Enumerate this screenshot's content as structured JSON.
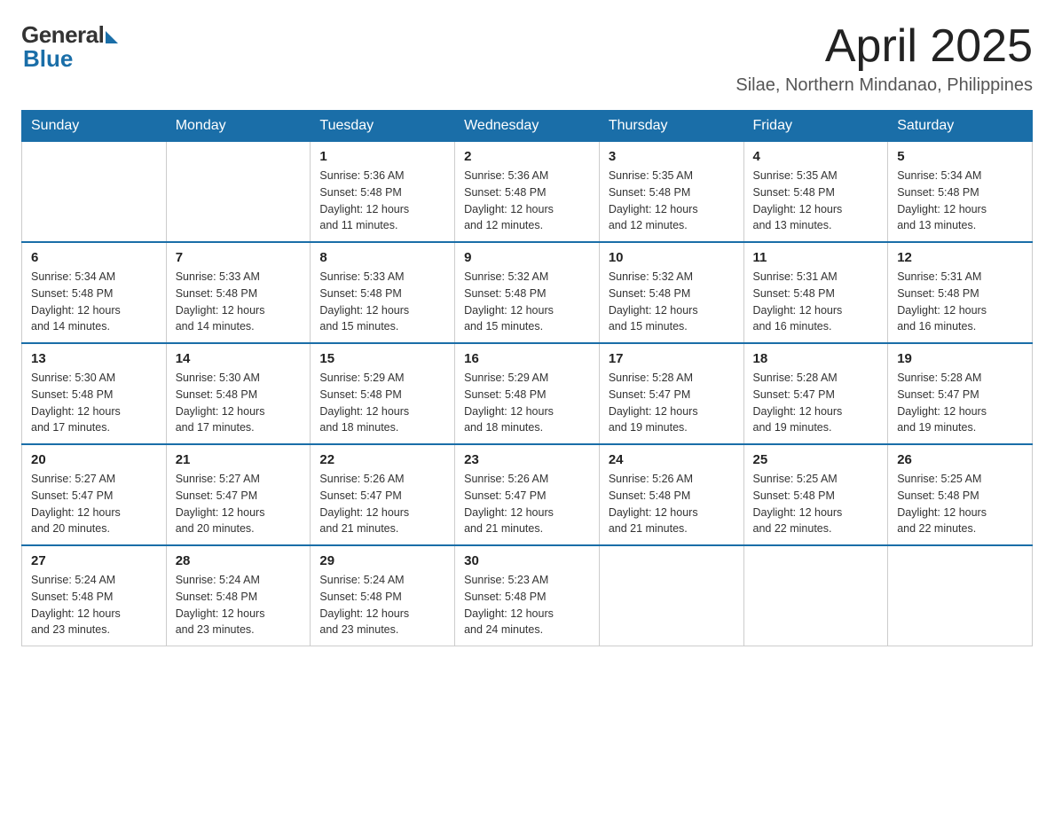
{
  "logo": {
    "general": "General",
    "blue": "Blue"
  },
  "header": {
    "month_year": "April 2025",
    "location": "Silae, Northern Mindanao, Philippines"
  },
  "columns": [
    "Sunday",
    "Monday",
    "Tuesday",
    "Wednesday",
    "Thursday",
    "Friday",
    "Saturday"
  ],
  "weeks": [
    [
      {
        "day": "",
        "info": ""
      },
      {
        "day": "",
        "info": ""
      },
      {
        "day": "1",
        "info": "Sunrise: 5:36 AM\nSunset: 5:48 PM\nDaylight: 12 hours\nand 11 minutes."
      },
      {
        "day": "2",
        "info": "Sunrise: 5:36 AM\nSunset: 5:48 PM\nDaylight: 12 hours\nand 12 minutes."
      },
      {
        "day": "3",
        "info": "Sunrise: 5:35 AM\nSunset: 5:48 PM\nDaylight: 12 hours\nand 12 minutes."
      },
      {
        "day": "4",
        "info": "Sunrise: 5:35 AM\nSunset: 5:48 PM\nDaylight: 12 hours\nand 13 minutes."
      },
      {
        "day": "5",
        "info": "Sunrise: 5:34 AM\nSunset: 5:48 PM\nDaylight: 12 hours\nand 13 minutes."
      }
    ],
    [
      {
        "day": "6",
        "info": "Sunrise: 5:34 AM\nSunset: 5:48 PM\nDaylight: 12 hours\nand 14 minutes."
      },
      {
        "day": "7",
        "info": "Sunrise: 5:33 AM\nSunset: 5:48 PM\nDaylight: 12 hours\nand 14 minutes."
      },
      {
        "day": "8",
        "info": "Sunrise: 5:33 AM\nSunset: 5:48 PM\nDaylight: 12 hours\nand 15 minutes."
      },
      {
        "day": "9",
        "info": "Sunrise: 5:32 AM\nSunset: 5:48 PM\nDaylight: 12 hours\nand 15 minutes."
      },
      {
        "day": "10",
        "info": "Sunrise: 5:32 AM\nSunset: 5:48 PM\nDaylight: 12 hours\nand 15 minutes."
      },
      {
        "day": "11",
        "info": "Sunrise: 5:31 AM\nSunset: 5:48 PM\nDaylight: 12 hours\nand 16 minutes."
      },
      {
        "day": "12",
        "info": "Sunrise: 5:31 AM\nSunset: 5:48 PM\nDaylight: 12 hours\nand 16 minutes."
      }
    ],
    [
      {
        "day": "13",
        "info": "Sunrise: 5:30 AM\nSunset: 5:48 PM\nDaylight: 12 hours\nand 17 minutes."
      },
      {
        "day": "14",
        "info": "Sunrise: 5:30 AM\nSunset: 5:48 PM\nDaylight: 12 hours\nand 17 minutes."
      },
      {
        "day": "15",
        "info": "Sunrise: 5:29 AM\nSunset: 5:48 PM\nDaylight: 12 hours\nand 18 minutes."
      },
      {
        "day": "16",
        "info": "Sunrise: 5:29 AM\nSunset: 5:48 PM\nDaylight: 12 hours\nand 18 minutes."
      },
      {
        "day": "17",
        "info": "Sunrise: 5:28 AM\nSunset: 5:47 PM\nDaylight: 12 hours\nand 19 minutes."
      },
      {
        "day": "18",
        "info": "Sunrise: 5:28 AM\nSunset: 5:47 PM\nDaylight: 12 hours\nand 19 minutes."
      },
      {
        "day": "19",
        "info": "Sunrise: 5:28 AM\nSunset: 5:47 PM\nDaylight: 12 hours\nand 19 minutes."
      }
    ],
    [
      {
        "day": "20",
        "info": "Sunrise: 5:27 AM\nSunset: 5:47 PM\nDaylight: 12 hours\nand 20 minutes."
      },
      {
        "day": "21",
        "info": "Sunrise: 5:27 AM\nSunset: 5:47 PM\nDaylight: 12 hours\nand 20 minutes."
      },
      {
        "day": "22",
        "info": "Sunrise: 5:26 AM\nSunset: 5:47 PM\nDaylight: 12 hours\nand 21 minutes."
      },
      {
        "day": "23",
        "info": "Sunrise: 5:26 AM\nSunset: 5:47 PM\nDaylight: 12 hours\nand 21 minutes."
      },
      {
        "day": "24",
        "info": "Sunrise: 5:26 AM\nSunset: 5:48 PM\nDaylight: 12 hours\nand 21 minutes."
      },
      {
        "day": "25",
        "info": "Sunrise: 5:25 AM\nSunset: 5:48 PM\nDaylight: 12 hours\nand 22 minutes."
      },
      {
        "day": "26",
        "info": "Sunrise: 5:25 AM\nSunset: 5:48 PM\nDaylight: 12 hours\nand 22 minutes."
      }
    ],
    [
      {
        "day": "27",
        "info": "Sunrise: 5:24 AM\nSunset: 5:48 PM\nDaylight: 12 hours\nand 23 minutes."
      },
      {
        "day": "28",
        "info": "Sunrise: 5:24 AM\nSunset: 5:48 PM\nDaylight: 12 hours\nand 23 minutes."
      },
      {
        "day": "29",
        "info": "Sunrise: 5:24 AM\nSunset: 5:48 PM\nDaylight: 12 hours\nand 23 minutes."
      },
      {
        "day": "30",
        "info": "Sunrise: 5:23 AM\nSunset: 5:48 PM\nDaylight: 12 hours\nand 24 minutes."
      },
      {
        "day": "",
        "info": ""
      },
      {
        "day": "",
        "info": ""
      },
      {
        "day": "",
        "info": ""
      }
    ]
  ]
}
